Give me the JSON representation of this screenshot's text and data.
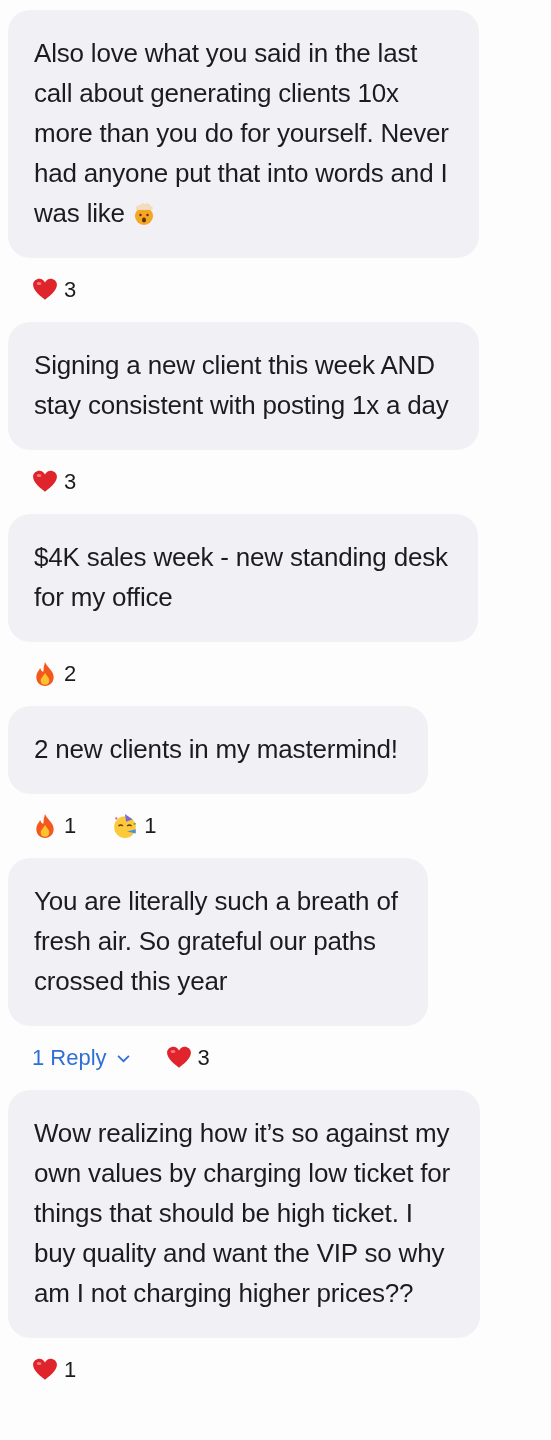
{
  "comments": [
    {
      "lines": [
        "Also love what you said in the last",
        "call about generating clients 10x",
        "more than you do for yourself. Never",
        "had anyone put that into words and I",
        "was like"
      ],
      "ends_with_emoji": true,
      "reactions": [
        {
          "kind": "heart",
          "count": "3"
        }
      ]
    },
    {
      "lines": [
        "Signing a new client this week AND",
        "stay consistent with posting 1x a day"
      ],
      "reactions": [
        {
          "kind": "heart",
          "count": "3"
        }
      ]
    },
    {
      "lines": [
        "$4K sales week - new standing desk",
        "for my office"
      ],
      "reactions": [
        {
          "kind": "fire",
          "count": "2"
        }
      ]
    },
    {
      "lines": [
        "2 new clients in my mastermind!"
      ],
      "reactions": [
        {
          "kind": "fire",
          "count": "1"
        },
        {
          "kind": "party",
          "count": "1"
        }
      ]
    },
    {
      "lines": [
        "You are literally such a breath of",
        "fresh air. So grateful our paths",
        "crossed this year"
      ],
      "reply_link": "1 Reply",
      "reactions": [
        {
          "kind": "heart",
          "count": "3"
        }
      ]
    },
    {
      "lines": [
        "Wow realizing how it’s so against my",
        "own values by charging low ticket for",
        "things that should be high ticket. I",
        "buy quality and want the VIP so why",
        "am I not charging higher prices??"
      ],
      "reactions": [
        {
          "kind": "heart",
          "count": "1"
        }
      ]
    }
  ]
}
